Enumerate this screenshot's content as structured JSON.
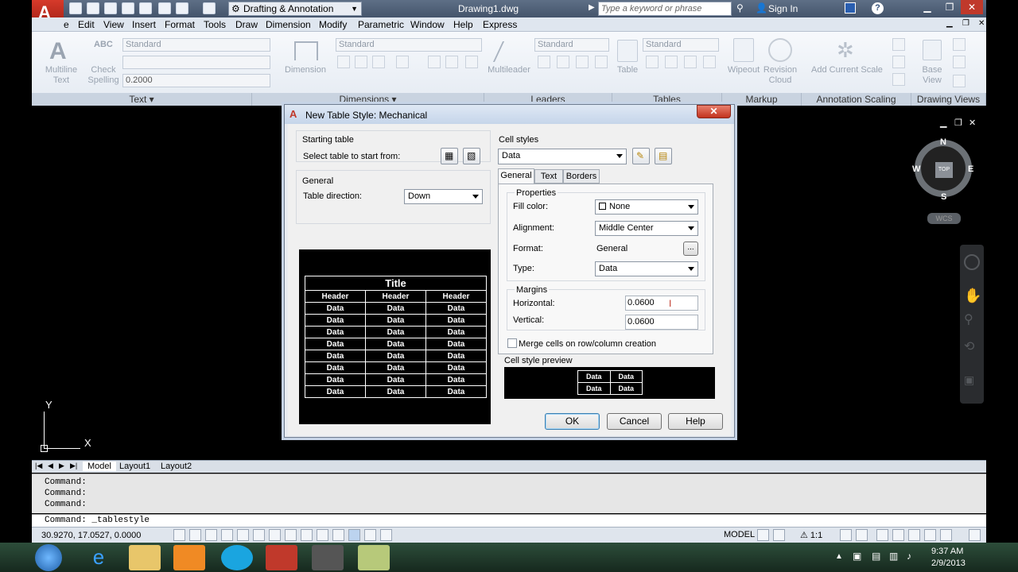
{
  "titlebar": {
    "workspace": "Drafting & Annotation",
    "document": "Drawing1.dwg",
    "search_placeholder": "Type a keyword or phrase",
    "sign_in": "Sign In"
  },
  "menus": [
    "Edit",
    "View",
    "Insert",
    "Format",
    "Tools",
    "Draw",
    "Dimension",
    "Modify",
    "Parametric",
    "Window",
    "Help",
    "Express"
  ],
  "menu_cut": "e",
  "ribbon": {
    "text_panel": {
      "multiline_text": "Multiline Text",
      "check_spelling": "Check Spelling",
      "style": "Standard",
      "height": "0.2000",
      "title": "Text"
    },
    "dimensions_panel": {
      "dimension": "Dimension",
      "style": "Standard",
      "title": "Dimensions"
    },
    "leaders_panel": {
      "multileader": "Multileader",
      "style": "Standard",
      "title": "Leaders"
    },
    "tables_panel": {
      "table": "Table",
      "style": "Standard",
      "title": "Tables"
    },
    "markup_panel": {
      "wipeout": "Wipeout",
      "revision_cloud": "Revision Cloud",
      "title": "Markup"
    },
    "annotation_panel": {
      "add_current_scale": "Add Current Scale",
      "title": "Annotation Scaling"
    },
    "views_panel": {
      "base_view": "Base View",
      "title": "Drawing Views"
    }
  },
  "viewcube": {
    "n": "N",
    "s": "S",
    "e": "E",
    "w": "W",
    "top": "TOP",
    "wcs": "WCS"
  },
  "ucs": {
    "x": "X",
    "y": "Y"
  },
  "layout_tabs": [
    "Model",
    "Layout1",
    "Layout2"
  ],
  "command": {
    "history": [
      "Command:",
      "Command:",
      "Command:"
    ],
    "current": "Command:  _tablestyle"
  },
  "status": {
    "coords": "30.9270, 17.0527, 0.0000",
    "model": "MODEL",
    "scale": "1:1"
  },
  "taskbar": {
    "time": "9:37 AM",
    "date": "2/9/2013"
  },
  "dialog": {
    "title": "New Table Style: Mechanical",
    "starting_table_label": "Starting table",
    "select_table_label": "Select table to start from:",
    "general_label": "General",
    "table_direction_label": "Table direction:",
    "table_direction_value": "Down",
    "cell_styles_label": "Cell styles",
    "cell_style_value": "Data",
    "tabs": [
      "General",
      "Text",
      "Borders"
    ],
    "properties_label": "Properties",
    "fill_color_label": "Fill color:",
    "fill_color_value": "None",
    "alignment_label": "Alignment:",
    "alignment_value": "Middle Center",
    "format_label": "Format:",
    "format_value": "General",
    "format_btn": "...",
    "type_label": "Type:",
    "type_value": "Data",
    "margins_label": "Margins",
    "horizontal_label": "Horizontal:",
    "horizontal_value": "0.0600",
    "vertical_label": "Vertical:",
    "vertical_value": "0.0600",
    "merge_label": "Merge cells on row/column creation",
    "cell_preview_label": "Cell style preview",
    "ok": "OK",
    "cancel": "Cancel",
    "help": "Help"
  },
  "table_preview": {
    "title": "Title",
    "headers": [
      "Header",
      "Header",
      "Header"
    ],
    "rows": [
      [
        "Data",
        "Data",
        "Data"
      ],
      [
        "Data",
        "Data",
        "Data"
      ],
      [
        "Data",
        "Data",
        "Data"
      ],
      [
        "Data",
        "Data",
        "Data"
      ],
      [
        "Data",
        "Data",
        "Data"
      ],
      [
        "Data",
        "Data",
        "Data"
      ],
      [
        "Data",
        "Data",
        "Data"
      ],
      [
        "Data",
        "Data",
        "Data"
      ]
    ]
  },
  "cell_preview": {
    "rows": [
      [
        "Data",
        "Data"
      ],
      [
        "Data",
        "Data"
      ]
    ]
  }
}
